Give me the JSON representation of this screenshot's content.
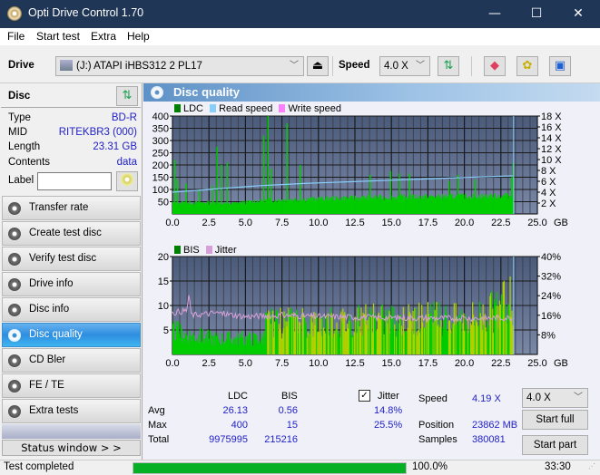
{
  "window": {
    "title": "Opti Drive Control 1.70",
    "minimize": "—",
    "maximize": "☐",
    "close": "✕"
  },
  "menu": {
    "items": [
      "File",
      "Start test",
      "Extra",
      "Help"
    ]
  },
  "toolbar": {
    "drive_label": "Drive",
    "drive_value": "(J:)  ATAPI iHBS312  2 PL17",
    "speed_label": "Speed",
    "speed_value": "4.0 X"
  },
  "disc": {
    "title": "Disc",
    "rows": [
      {
        "key": "Type",
        "value": "BD-R"
      },
      {
        "key": "MID",
        "value": "RITEKBR3 (000)"
      },
      {
        "key": "Length",
        "value": "23.31 GB"
      },
      {
        "key": "Contents",
        "value": "data"
      }
    ],
    "label_key": "Label",
    "label_value": ""
  },
  "nav": {
    "items": [
      {
        "label": "Transfer rate",
        "active": false
      },
      {
        "label": "Create test disc",
        "active": false
      },
      {
        "label": "Verify test disc",
        "active": false
      },
      {
        "label": "Drive info",
        "active": false
      },
      {
        "label": "Disc info",
        "active": false
      },
      {
        "label": "Disc quality",
        "active": true
      },
      {
        "label": "CD Bler",
        "active": false
      },
      {
        "label": "FE / TE",
        "active": false
      },
      {
        "label": "Extra tests",
        "active": false
      }
    ],
    "status_window": "Status window > >"
  },
  "panel": {
    "title": "Disc quality"
  },
  "colors": {
    "ldc": "#008000",
    "read_speed": "#87cefa",
    "write_speed": "#ff80ff",
    "bis": "#008000",
    "jitter": "#d8a0d8",
    "plot_bg_top": "#4a5a7a",
    "plot_bg_bottom": "#7a88a8",
    "bar_green": "#00cc00",
    "bar_yellow": "#b0d000"
  },
  "chart_data": [
    {
      "type": "bar",
      "legend": [
        "LDC",
        "Read speed",
        "Write speed"
      ],
      "xlabel": "GB",
      "x_ticks": [
        "0.0",
        "2.5",
        "5.0",
        "7.5",
        "10.0",
        "12.5",
        "15.0",
        "17.5",
        "20.0",
        "22.5",
        "25.0"
      ],
      "y_ticks_left": [
        "50",
        "100",
        "150",
        "200",
        "250",
        "300",
        "350",
        "400"
      ],
      "y_ticks_right": [
        "2 X",
        "4 X",
        "6 X",
        "8 X",
        "10 X",
        "12 X",
        "14 X",
        "16 X",
        "18 X"
      ],
      "xlim": [
        0,
        25
      ],
      "ylim_left": [
        0,
        400
      ],
      "ylim_right": [
        0,
        18
      ],
      "ldc_baseline": [
        [
          0,
          45
        ],
        [
          3.0,
          45
        ],
        [
          3.7,
          40
        ],
        [
          6.5,
          55
        ],
        [
          10,
          60
        ],
        [
          13,
          65
        ],
        [
          17,
          68
        ],
        [
          20,
          70
        ],
        [
          23.31,
          72
        ]
      ],
      "ldc_spikes": [
        [
          0.1,
          220
        ],
        [
          0.3,
          140
        ],
        [
          0.9,
          125
        ],
        [
          1.8,
          100
        ],
        [
          2.7,
          115
        ],
        [
          3.0,
          275
        ],
        [
          3.3,
          200
        ],
        [
          3.7,
          210
        ],
        [
          6.2,
          320
        ],
        [
          6.5,
          400
        ],
        [
          6.7,
          185
        ],
        [
          7.8,
          370
        ],
        [
          8.7,
          200
        ],
        [
          13.5,
          160
        ],
        [
          14.9,
          175
        ],
        [
          15.5,
          165
        ],
        [
          16.2,
          165
        ],
        [
          18.9,
          135
        ],
        [
          19.5,
          160
        ],
        [
          20.7,
          140
        ],
        [
          22.8,
          85
        ],
        [
          23.2,
          150
        ],
        [
          23.3,
          210
        ]
      ],
      "read_speed_x": [
        [
          0,
          4.0
        ],
        [
          1.0,
          4.2
        ],
        [
          2.0,
          4.4
        ],
        [
          3.0,
          4.6
        ],
        [
          4.0,
          4.8
        ],
        [
          5.0,
          5.0
        ],
        [
          6.0,
          5.2
        ],
        [
          7.5,
          5.4
        ],
        [
          9.0,
          5.6
        ],
        [
          11.0,
          5.8
        ],
        [
          13.0,
          6.0
        ],
        [
          15.0,
          6.2
        ],
        [
          17.0,
          6.4
        ],
        [
          19.0,
          6.6
        ],
        [
          21.0,
          6.8
        ],
        [
          23.31,
          7.0
        ]
      ]
    },
    {
      "type": "bar",
      "legend": [
        "BIS",
        "Jitter"
      ],
      "xlabel": "GB",
      "x_ticks": [
        "0.0",
        "2.5",
        "5.0",
        "7.5",
        "10.0",
        "12.5",
        "15.0",
        "17.5",
        "20.0",
        "22.5",
        "25.0"
      ],
      "y_ticks_left": [
        "5",
        "10",
        "15",
        "20"
      ],
      "y_ticks_right": [
        "8%",
        "16%",
        "24%",
        "32%",
        "40%"
      ],
      "xlim": [
        0,
        25
      ],
      "ylim_left": [
        0,
        20
      ],
      "ylim_right": [
        0,
        40
      ],
      "bis_profile": [
        [
          0,
          6
        ],
        [
          1.0,
          5
        ],
        [
          3.0,
          4
        ],
        [
          6.2,
          4
        ],
        [
          6.4,
          8
        ],
        [
          10,
          8
        ],
        [
          15,
          9
        ],
        [
          20,
          9
        ],
        [
          22,
          11
        ],
        [
          23.31,
          14
        ]
      ],
      "jitter_profile_pct": [
        [
          0,
          17
        ],
        [
          1.0,
          18
        ],
        [
          1.1,
          25
        ],
        [
          1.3,
          16
        ],
        [
          3.0,
          17
        ],
        [
          5.0,
          15.5
        ],
        [
          7.5,
          16
        ],
        [
          10,
          15.5
        ],
        [
          15,
          15
        ],
        [
          20,
          14.8
        ],
        [
          23.31,
          15
        ]
      ]
    }
  ],
  "stats": {
    "col_ldc": "LDC",
    "col_bis": "BIS",
    "col_jitter": "Jitter",
    "avg_label": "Avg",
    "max_label": "Max",
    "total_label": "Total",
    "avg_ldc": "26.13",
    "avg_bis": "0.56",
    "avg_jitter": "14.8%",
    "max_ldc": "400",
    "max_bis": "15",
    "max_jitter": "25.5%",
    "total_ldc": "9975995",
    "total_bis": "215216",
    "jitter_checked": true,
    "speed_label": "Speed",
    "speed_value": "4.19 X",
    "position_label": "Position",
    "position_value": "23862 MB",
    "samples_label": "Samples",
    "samples_value": "380081",
    "speed_select": "4.0 X",
    "start_full": "Start full",
    "start_part": "Start part"
  },
  "status": {
    "text": "Test completed",
    "progress": 1.0,
    "progress_text": "100.0%",
    "time": "33:30"
  }
}
